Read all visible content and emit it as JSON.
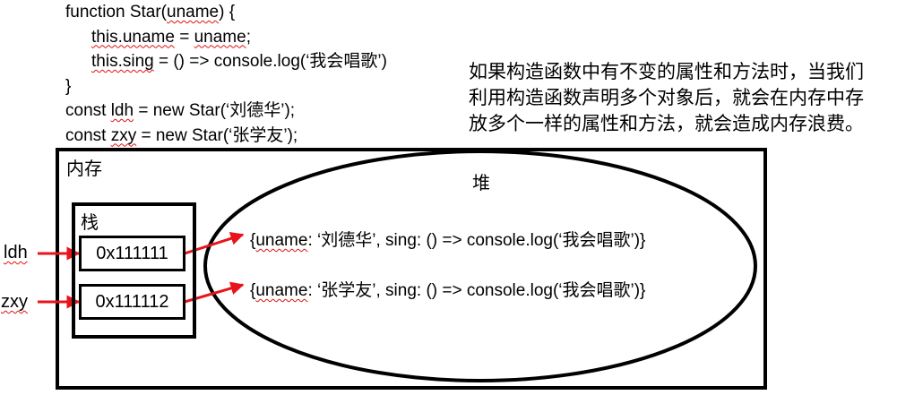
{
  "code_lines": [
    "function Star(uname) {",
    "this.uname = uname;",
    "this.sing = () => console.log(‘我会唱歌’)",
    "}",
    "const ldh = new Star(‘刘德华’);",
    "const zxy = new Star(‘张学友’);"
  ],
  "note_lines": [
    "如果构造函数中有不变的属性和方法时，当我们",
    "利用构造函数声明多个对象后，就会在内存中存",
    "放多个一样的属性和方法，就会造成内存浪费。"
  ],
  "memory_label": "内存",
  "heap_label": "堆",
  "stack_label": "栈",
  "variables": [
    {
      "name": "ldh",
      "address": "0x111111",
      "object": "{uname: ‘刘德华’, sing: () => console.log(‘我会唱歌’)}"
    },
    {
      "name": "zxy",
      "address": "0x111112",
      "object": "{uname: ‘张学友’, sing: () => console.log(‘我会唱歌’)}"
    }
  ],
  "colors": {
    "arrow": "#e8141b",
    "squiggle": "#d11111",
    "border": "#000000"
  }
}
